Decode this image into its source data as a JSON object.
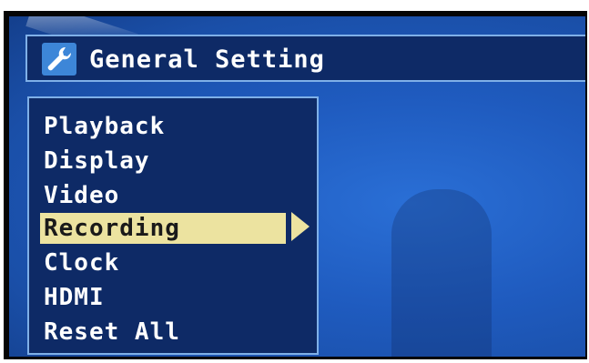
{
  "header": {
    "title": "General Setting",
    "icon": "wrench-icon"
  },
  "menu": {
    "items": [
      {
        "label": "Playback",
        "selected": false
      },
      {
        "label": "Display",
        "selected": false
      },
      {
        "label": "Video",
        "selected": false
      },
      {
        "label": "Recording",
        "selected": true
      },
      {
        "label": "Clock",
        "selected": false
      },
      {
        "label": "HDMI",
        "selected": false
      },
      {
        "label": "Reset All",
        "selected": false
      }
    ],
    "submenu_indicator": "right-arrow-icon"
  },
  "colors": {
    "panel": "#0e2a66",
    "border": "#7fb0e8",
    "highlight": "#ece3a0",
    "background": "#1f5bbf"
  }
}
